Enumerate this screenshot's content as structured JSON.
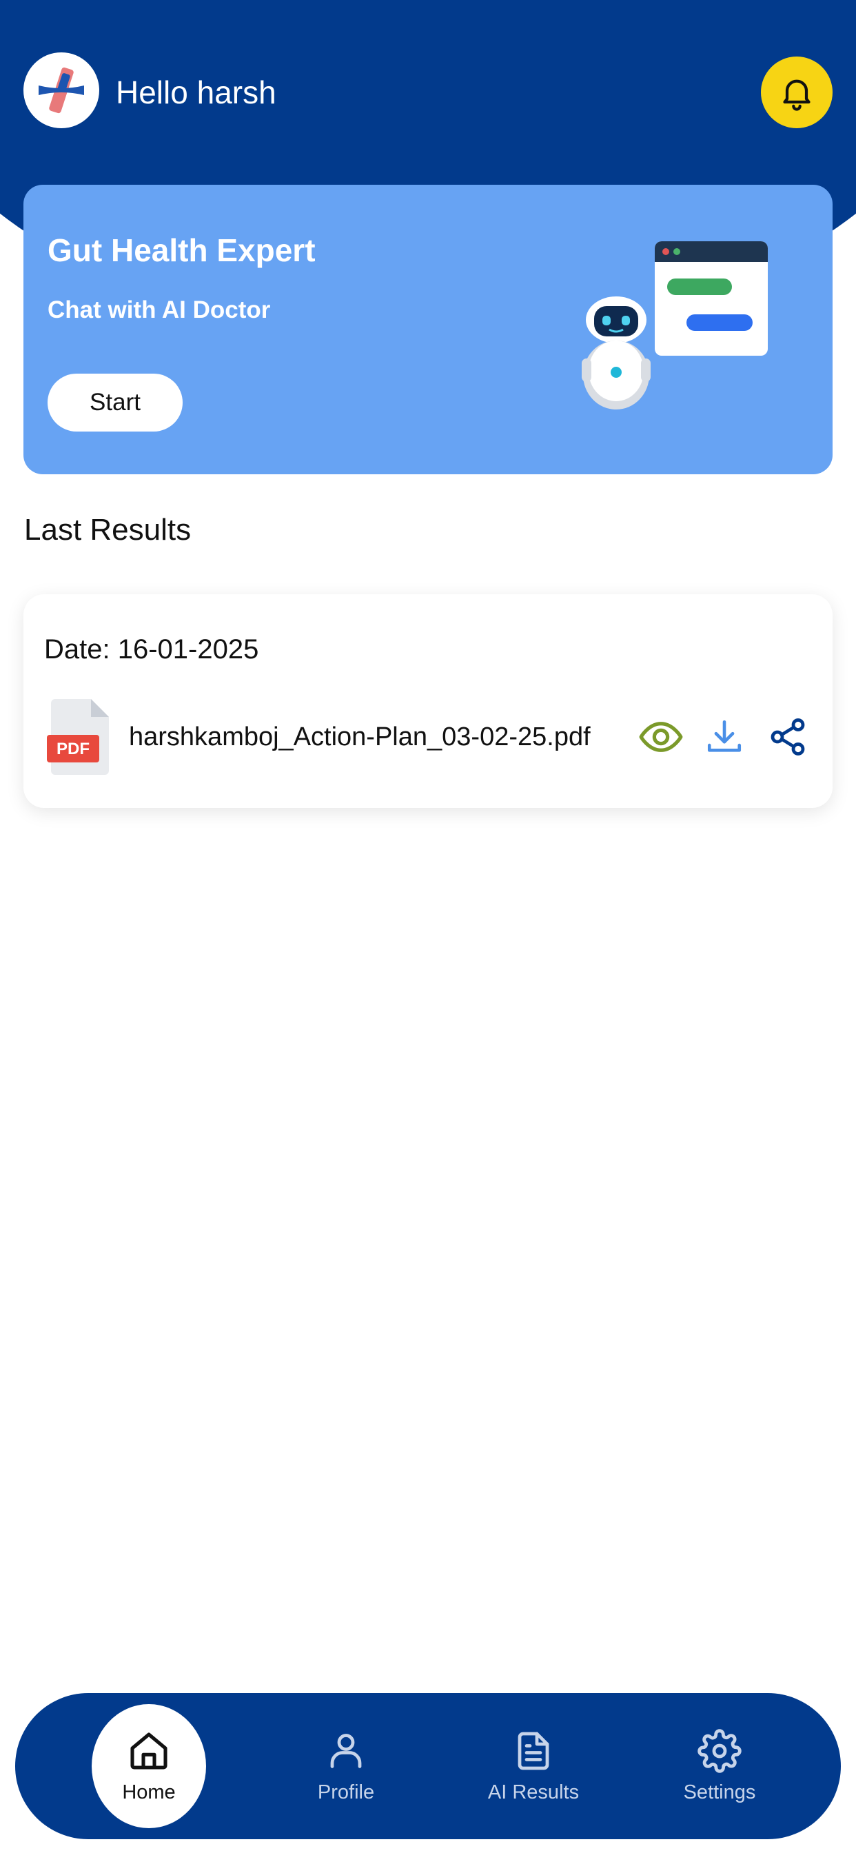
{
  "header": {
    "greeting": "Hello harsh",
    "logo_icon": "medical-cross-logo",
    "notification_icon": "bell-icon",
    "bg_color": "#023a8c",
    "bell_color": "#f7d414"
  },
  "banner": {
    "title": "Gut Health Expert",
    "subtitle": "Chat with AI Doctor",
    "start_label": "Start",
    "illustration": "robot-chat-illustration",
    "bg_color": "#67a3f3"
  },
  "last_results": {
    "title": "Last Results",
    "items": [
      {
        "date_label": "Date: 16-01-2025",
        "file_type_badge": "PDF",
        "file_name": "harshkamboj_Action-Plan_03-02-25.pdf",
        "actions": [
          "eye-icon",
          "download-icon",
          "share-icon"
        ]
      }
    ]
  },
  "bottom_nav": {
    "items": [
      {
        "label": "Home",
        "icon": "home-icon",
        "active": true
      },
      {
        "label": "Profile",
        "icon": "user-icon",
        "active": false
      },
      {
        "label": "AI Results",
        "icon": "document-icon",
        "active": false
      },
      {
        "label": "Settings",
        "icon": "gear-icon",
        "active": false
      }
    ]
  }
}
